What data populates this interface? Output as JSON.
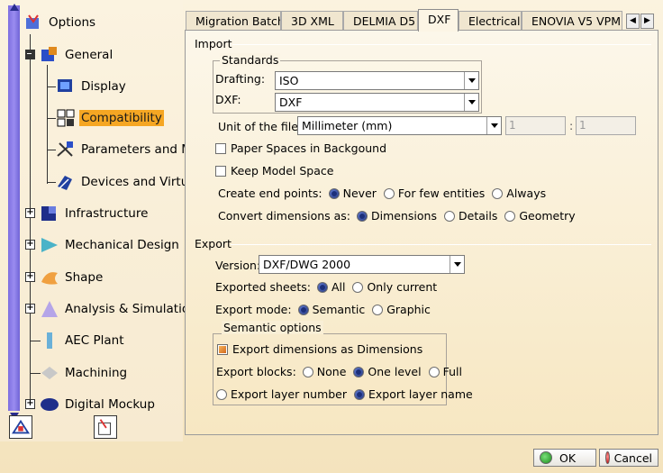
{
  "tree": {
    "root": {
      "label": "Options",
      "icon": "options-icon"
    },
    "items": [
      {
        "label": "General",
        "icon": "general-icon"
      },
      {
        "label": "Display",
        "icon": "display-icon"
      },
      {
        "label": "Compatibility",
        "icon": "compatibility-icon"
      },
      {
        "label": "Parameters and M",
        "icon": "parameters-icon"
      },
      {
        "label": "Devices and Virtu",
        "icon": "devices-icon"
      },
      {
        "label": "Infrastructure",
        "icon": "infrastructure-icon"
      },
      {
        "label": "Mechanical Design",
        "icon": "mechanical-design-icon"
      },
      {
        "label": "Shape",
        "icon": "shape-icon"
      },
      {
        "label": "Analysis & Simulatio",
        "icon": "analysis-icon"
      },
      {
        "label": "AEC Plant",
        "icon": "aec-plant-icon"
      },
      {
        "label": "Machining",
        "icon": "machining-icon"
      },
      {
        "label": "Digital Mockup",
        "icon": "digital-mockup-icon"
      }
    ]
  },
  "tabs": [
    "Migration Batch",
    "3D XML",
    "DELMIA D5",
    "DXF",
    "Electrical",
    "ENOVIA V5 VPM"
  ],
  "import": {
    "title": "Import",
    "standards_title": "Standards",
    "drafting_label": "Drafting:",
    "drafting_value": "ISO",
    "dxf_label": "DXF:",
    "dxf_value": "DXF",
    "unit_label": "Unit of the file:",
    "unit_value": "Millimeter (mm)",
    "spin1": "1",
    "spin_sep": ":",
    "spin2": "1",
    "paper_spaces": "Paper Spaces in Backgound",
    "keep_model": "Keep Model Space",
    "end_points_label": "Create end points:",
    "end_points": [
      "Never",
      "For few entities",
      "Always"
    ],
    "convert_label": "Convert dimensions as:",
    "convert": [
      "Dimensions",
      "Details",
      "Geometry"
    ]
  },
  "export": {
    "title": "Export",
    "version_label": "Version:",
    "version_value": "DXF/DWG 2000",
    "sheets_label": "Exported sheets:",
    "sheets": [
      "All",
      "Only current"
    ],
    "mode_label": "Export mode:",
    "mode": [
      "Semantic",
      "Graphic"
    ],
    "semantic_title": "Semantic options",
    "export_dims": "Export dimensions as Dimensions",
    "blocks_label": "Export blocks:",
    "blocks": [
      "None",
      "One level",
      "Full"
    ],
    "layer": [
      "Export layer number",
      "Export layer name"
    ]
  },
  "buttons": {
    "ok": "OK",
    "cancel": "Cancel"
  },
  "colors": {
    "selection": "#f5a623",
    "accent": "#1c2f7a"
  }
}
